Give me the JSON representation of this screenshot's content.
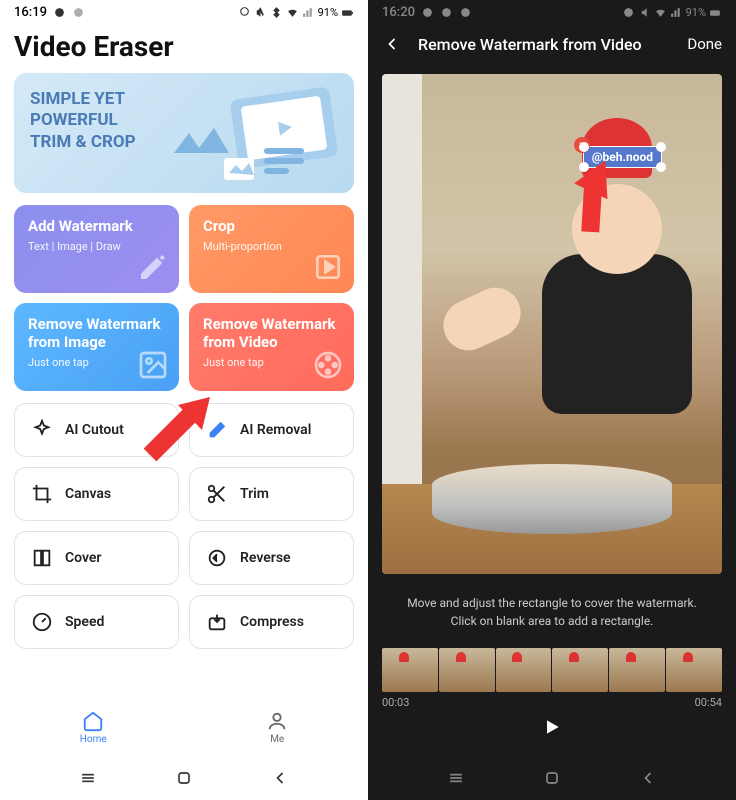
{
  "left": {
    "status": {
      "time": "16:19",
      "battery": "91%"
    },
    "app_title": "Video Eraser",
    "banner": {
      "line1": "SIMPLE YET",
      "line2": "POWERFUL",
      "line3": "TRIM & CROP"
    },
    "cards": [
      {
        "title": "Add Watermark",
        "sub": "Text | Image | Draw"
      },
      {
        "title": "Crop",
        "sub": "Multi-proportion"
      },
      {
        "title": "Remove Watermark from Image",
        "sub": "Just one tap"
      },
      {
        "title": "Remove Watermark from Video",
        "sub": "Just one tap"
      }
    ],
    "tools": [
      {
        "label": "AI Cutout"
      },
      {
        "label": "AI Removal"
      },
      {
        "label": "Canvas"
      },
      {
        "label": "Trim"
      },
      {
        "label": "Cover"
      },
      {
        "label": "Reverse"
      },
      {
        "label": "Speed"
      },
      {
        "label": "Compress"
      }
    ],
    "dock": {
      "home": "Home",
      "me": "Me"
    }
  },
  "right": {
    "status": {
      "time": "16:20",
      "battery": "91%"
    },
    "header": {
      "title": "Remove Watermark from Video",
      "done": "Done"
    },
    "watermark_text": "@beh.nood",
    "instruction1": "Move and adjust the rectangle to cover the watermark.",
    "instruction2": "Click on blank area to add a rectangle.",
    "time_start": "00:03",
    "time_end": "00:54"
  }
}
